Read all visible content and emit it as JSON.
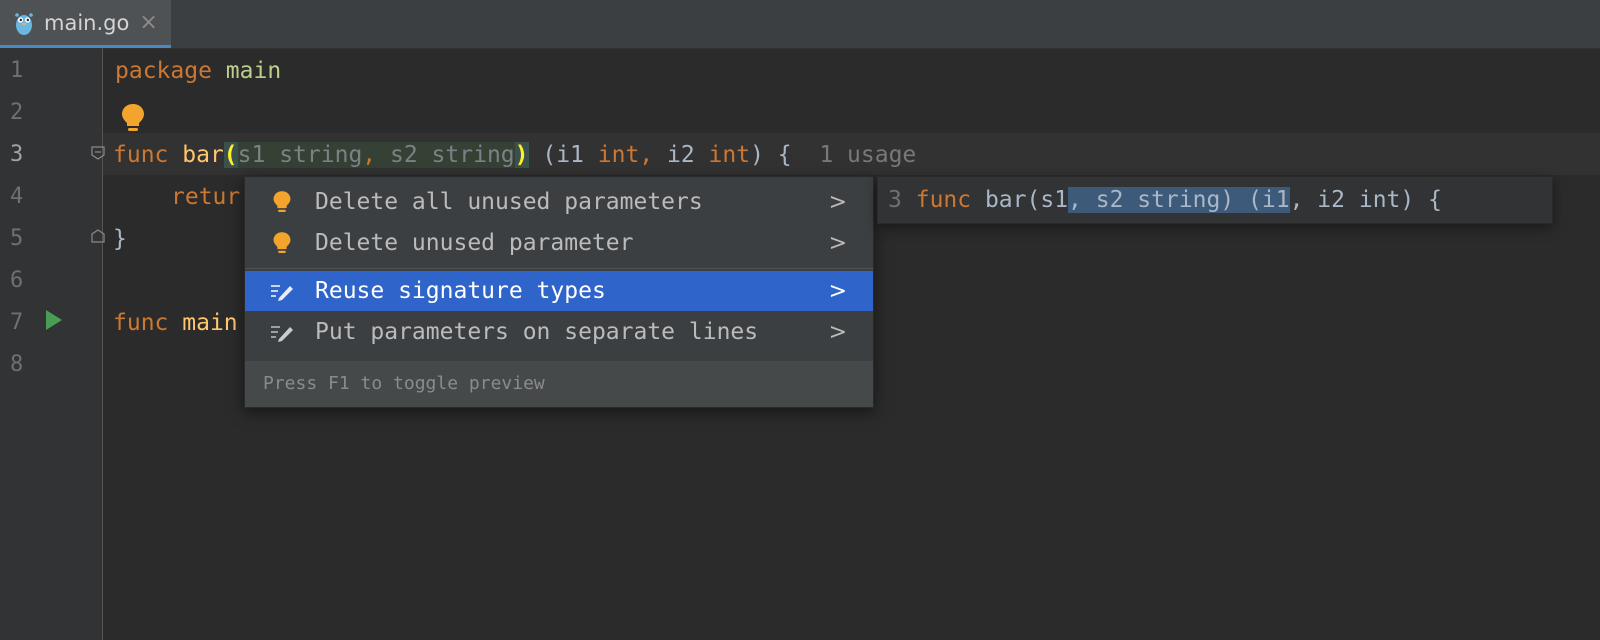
{
  "tab": {
    "title": "main.go",
    "close": "×",
    "icon": "go-gopher-icon"
  },
  "gutter": {
    "line_numbers": [
      "1",
      "2",
      "3",
      "4",
      "5",
      "6",
      "7",
      "8"
    ],
    "current_line": "3"
  },
  "code": {
    "line1": {
      "kw": "package",
      "name": "main"
    },
    "line3": {
      "kw_func": "func",
      "fn_name": "bar",
      "open_paren": "(",
      "param1_name": "s1",
      "param1_type": " string",
      "comma1": ",",
      "param2_name": " s2",
      "param2_type": " string",
      "close_paren": ")",
      "sep": " ",
      "result_open": "(i1 ",
      "result_type1": "int",
      "result_comma": ",",
      "result_name2": " i2 ",
      "result_type2": "int",
      "result_close": ") {",
      "usage_hint": "1 usage"
    },
    "line4": {
      "kw_return": "retur"
    },
    "line5": {
      "brace": "}"
    },
    "line7": {
      "kw_func": "func",
      "fn_name": "main"
    }
  },
  "intention_popup": {
    "items": [
      {
        "label": "Delete all unused parameters",
        "icon": "lightbulb-icon",
        "chevron": ">"
      },
      {
        "label": "Delete unused parameter",
        "icon": "lightbulb-icon",
        "chevron": ">"
      },
      {
        "label": "Reuse signature types",
        "icon": "edit-pencil-icon",
        "chevron": ">",
        "selected": true
      },
      {
        "label": "Put parameters on separate lines",
        "icon": "edit-pencil-icon",
        "chevron": ">"
      }
    ],
    "footer": "Press F1 to toggle preview"
  },
  "preview": {
    "line_number": "3",
    "kw_func": "func",
    "text_a": " bar(s1",
    "diff_a": ", s2 string) (i1",
    "text_b": ", i2 int) {"
  },
  "colors": {
    "editor_bg": "#2b2b2b",
    "keyword": "#cc7832",
    "function": "#ffc66d",
    "selection": "#2f65ca",
    "bulb": "#f2a42d"
  }
}
